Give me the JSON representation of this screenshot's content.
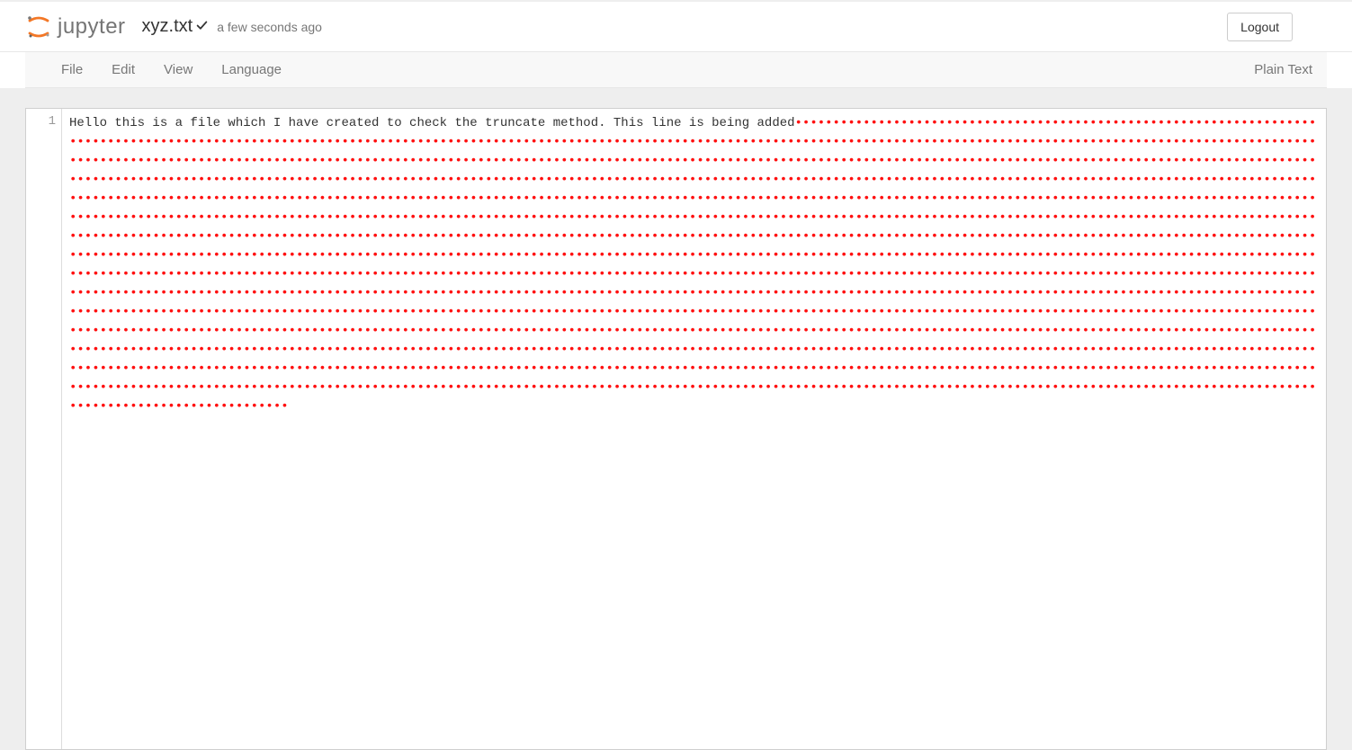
{
  "header": {
    "brand": "jupyter",
    "filename": "xyz.txt",
    "saved_ago": "a few seconds ago",
    "logout_label": "Logout"
  },
  "menubar": {
    "items": [
      "File",
      "Edit",
      "View",
      "Language"
    ],
    "mode": "Plain Text"
  },
  "editor": {
    "first_line_number": "1",
    "line1_text": "Hello this is a file which I have created to check the truncate method. This line is being added",
    "invalid_chars": {
      "glyph": "•",
      "count": 2408
    }
  }
}
